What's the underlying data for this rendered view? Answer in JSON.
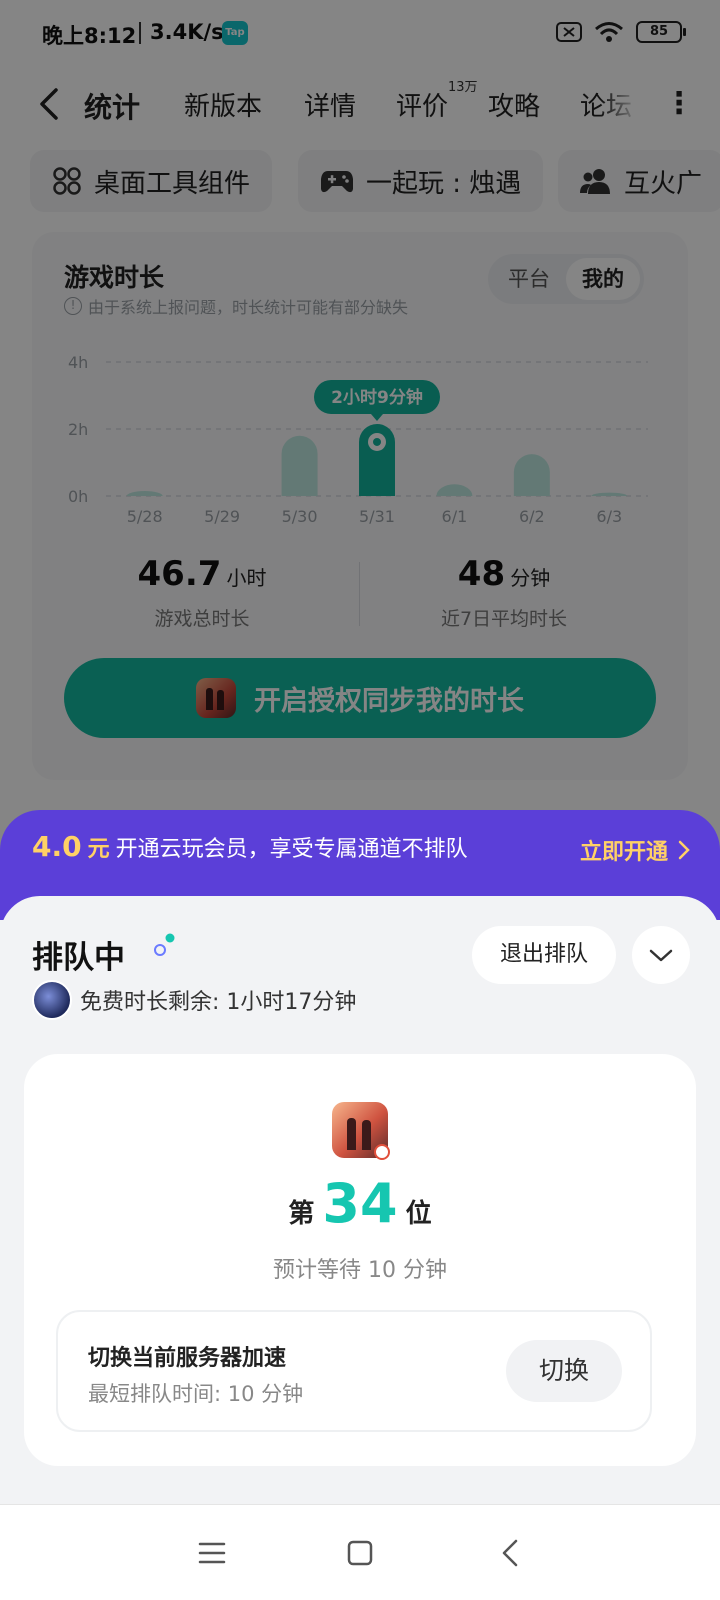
{
  "status_bar": {
    "time": "晚上8:12",
    "network_speed": "3.4K/s",
    "tap_badge": "Tap",
    "battery": "85"
  },
  "nav": {
    "tabs": [
      {
        "label": "统计",
        "active": true
      },
      {
        "label": "新版本"
      },
      {
        "label": "详情"
      },
      {
        "label": "评价",
        "superscript": "13万"
      },
      {
        "label": "攻略"
      },
      {
        "label": "论坛"
      }
    ]
  },
  "chips": [
    {
      "label": "桌面工具组件",
      "icon": "grid-icon"
    },
    {
      "label": "一起玩 : 烛遇",
      "icon": "gamepad-icon"
    },
    {
      "label": "互火广",
      "icon": "group-icon"
    }
  ],
  "stats": {
    "title": "游戏时长",
    "note": "由于系统上报问题，时长统计可能有部分缺失",
    "segment": {
      "options": [
        "平台",
        "我的"
      ],
      "selected": "我的"
    },
    "total_value": "46.7",
    "total_unit": "小时",
    "total_caption": "游戏总时长",
    "avg_value": "48",
    "avg_unit": "分钟",
    "avg_caption": "近7日平均时长",
    "sync_button": "开启授权同步我的时长"
  },
  "chart_data": {
    "type": "bar",
    "categories": [
      "5/28",
      "5/29",
      "5/30",
      "5/31",
      "6/1",
      "6/2",
      "6/3"
    ],
    "values": [
      0.15,
      0,
      1.8,
      2.15,
      0.35,
      1.25,
      0.1
    ],
    "unit": "h",
    "yticks": [
      "0h",
      "2h",
      "4h"
    ],
    "ylim": [
      0,
      4
    ],
    "highlight_index": 3,
    "highlight_label": "2小时9分钟",
    "grid": true,
    "colors": {
      "bar": "#bfe9e1",
      "highlight": "#12b39c"
    }
  },
  "promo": {
    "price": "4.0",
    "currency": "元",
    "text": "开通云玩会员，享受专属通道不排队",
    "cta": "立即开通"
  },
  "queue": {
    "title": "排队中",
    "free_time": "免费时长剩余: 1小时17分钟",
    "exit_button": "退出排队",
    "rank_prefix": "第",
    "rank": "34",
    "rank_suffix": "位",
    "wait": "预计等待 10 分钟",
    "server_title": "切换当前服务器加速",
    "server_sub": "最短排队时间: 10 分钟",
    "switch_button": "切换"
  },
  "colors": {
    "accent": "#14b8a0",
    "promo_bg": "#5b3fd8",
    "promo_highlight": "#ffd166"
  }
}
